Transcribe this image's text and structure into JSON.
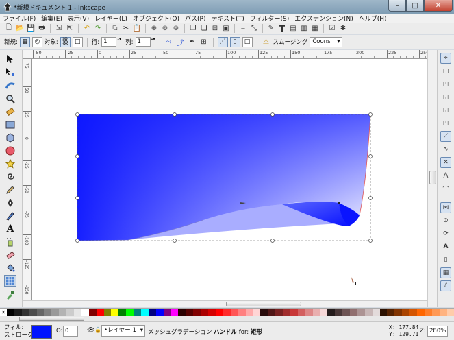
{
  "window": {
    "title": "*新規ドキュメント 1 - Inkscape",
    "buttons": [
      "–",
      "□",
      "✕"
    ]
  },
  "menu": [
    "ファイル(F)",
    "編集(E)",
    "表示(V)",
    "レイヤー(L)",
    "オブジェクト(O)",
    "パス(P)",
    "テキスト(T)",
    "フィルター(S)",
    "エクステンション(N)",
    "ヘルプ(H)"
  ],
  "controls": {
    "new_label": "新規:",
    "target_label": "対象:",
    "rows_label": "行:",
    "rows_value": "1",
    "cols_label": "列:",
    "cols_value": "1",
    "smoothing_label": "スムージング",
    "smoothing_value": "Coons"
  },
  "ruler": {
    "h_ticks": [
      "-50",
      "-25",
      "0",
      "25",
      "50",
      "75",
      "100",
      "125",
      "150",
      "175",
      "200",
      "225",
      "250"
    ],
    "v_ticks": [
      "75",
      "50",
      "25",
      "0",
      "-25",
      "-50",
      "-75",
      "-100",
      "-125",
      "-150",
      "-175"
    ]
  },
  "palette": [
    "#000000",
    "#1a1a1a",
    "#333333",
    "#4d4d4d",
    "#666666",
    "#808080",
    "#999999",
    "#b3b3b3",
    "#cccccc",
    "#e6e6e6",
    "#ffffff",
    "#800000",
    "#ff0000",
    "#808000",
    "#ffff00",
    "#008000",
    "#00ff00",
    "#008080",
    "#00ffff",
    "#000080",
    "#0000ff",
    "#800080",
    "#ff00ff",
    "#2b0000",
    "#550000",
    "#800000",
    "#aa0000",
    "#d40000",
    "#ff0000",
    "#ff2a2a",
    "#ff5555",
    "#ff8080",
    "#ffaaaa",
    "#ffd5d5",
    "#280b0b",
    "#501616",
    "#782121",
    "#a02c2c",
    "#c83737",
    "#d35f5f",
    "#de8787",
    "#e9afaf",
    "#f4d7d7",
    "#241c1c",
    "#483737",
    "#6c5353",
    "#916f6f",
    "#ac9393",
    "#c8b7b7",
    "#e3dbdb",
    "#2b1100",
    "#552200",
    "#803300",
    "#aa4400",
    "#d45500",
    "#ff6600",
    "#ff7f2a",
    "#ff9955",
    "#ffb380",
    "#ffccaa"
  ],
  "status": {
    "fill_label": "フィル:",
    "stroke_label": "ストローク:",
    "fill_color": "#0014ff",
    "opacity_label": "O:",
    "opacity_value": "0",
    "layer": "•レイヤー 1",
    "message_prefix": "メッシュグラデーション ",
    "message_bold1": "ハンドル",
    "message_mid": " for: ",
    "message_bold2": "矩形",
    "x_label": "X:",
    "x_value": "177.84",
    "y_label": "Y:",
    "y_value": "129.71",
    "zoom_label": "Z:",
    "zoom_value": "280%"
  },
  "colors": {
    "mesh_blue": "#0a14ff",
    "canvas": "#ffffff",
    "selection": "#555555"
  }
}
